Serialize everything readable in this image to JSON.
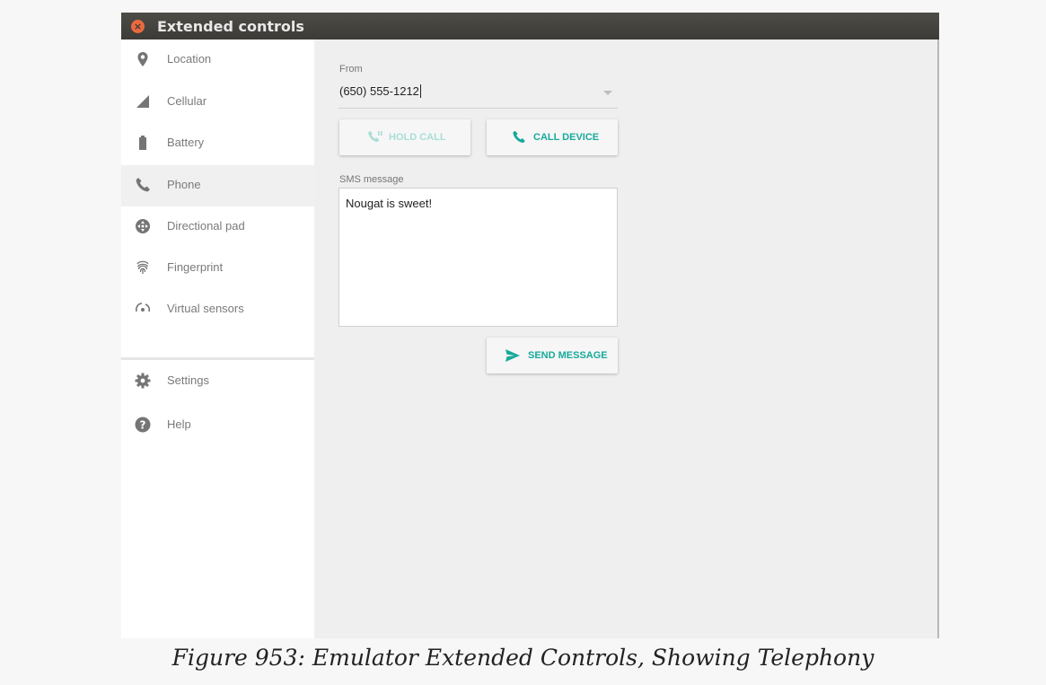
{
  "window": {
    "title": "Extended controls",
    "close_glyph": "×"
  },
  "sidebar": {
    "items": [
      {
        "label": "Location",
        "icon": "location-pin-icon"
      },
      {
        "label": "Cellular",
        "icon": "cellular-signal-icon"
      },
      {
        "label": "Battery",
        "icon": "battery-icon"
      },
      {
        "label": "Phone",
        "icon": "phone-icon",
        "active": true
      },
      {
        "label": "Directional pad",
        "icon": "dpad-icon"
      },
      {
        "label": "Fingerprint",
        "icon": "fingerprint-icon"
      },
      {
        "label": "Virtual sensors",
        "icon": "rotation-icon"
      }
    ],
    "footer_items": [
      {
        "label": "Settings",
        "icon": "gear-icon"
      },
      {
        "label": "Help",
        "icon": "help-icon"
      }
    ]
  },
  "phone": {
    "from_label": "From",
    "from_value": "(650) 555-1212",
    "hold_call_label": "HOLD CALL",
    "call_device_label": "CALL DEVICE",
    "sms_label": "SMS message",
    "sms_text": "Nougat is sweet!",
    "send_label": "SEND MESSAGE"
  },
  "colors": {
    "accent": "#17a99a",
    "icon_gray": "#757575",
    "close_button": "#ea6a3f"
  },
  "caption": "Figure 953: Emulator Extended Controls, Showing Telephony"
}
